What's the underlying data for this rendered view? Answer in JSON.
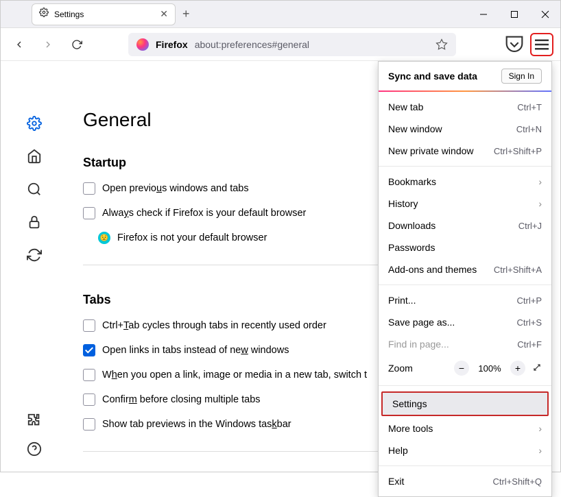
{
  "tab": {
    "title": "Settings"
  },
  "toolbar": {
    "brand": "Firefox",
    "url": "about:preferences#general"
  },
  "page": {
    "title": "General",
    "startup_heading": "Startup",
    "opt_prev": "Open previous windows and tabs",
    "opt_default": "Always check if Firefox is your default browser",
    "default_status": "Firefox is not your default browser",
    "tabs_heading": "Tabs",
    "opt_ctrltab": "Ctrl+Tab cycles through tabs in recently used order",
    "opt_openlinks": "Open links in tabs instead of new windows",
    "opt_switch": "When you open a link, image or media in a new tab, switch t",
    "opt_confirm": "Confirm before closing multiple tabs",
    "opt_taskbar": "Show tab previews in the Windows taskbar"
  },
  "menu": {
    "sync_title": "Sync and save data",
    "sign_in": "Sign In",
    "new_tab": "New tab",
    "new_tab_sc": "Ctrl+T",
    "new_window": "New window",
    "new_window_sc": "Ctrl+N",
    "new_private": "New private window",
    "new_private_sc": "Ctrl+Shift+P",
    "bookmarks": "Bookmarks",
    "history": "History",
    "downloads": "Downloads",
    "downloads_sc": "Ctrl+J",
    "passwords": "Passwords",
    "addons": "Add-ons and themes",
    "addons_sc": "Ctrl+Shift+A",
    "print": "Print...",
    "print_sc": "Ctrl+P",
    "save_as": "Save page as...",
    "save_as_sc": "Ctrl+S",
    "find": "Find in page...",
    "find_sc": "Ctrl+F",
    "zoom": "Zoom",
    "zoom_value": "100%",
    "settings": "Settings",
    "more_tools": "More tools",
    "help": "Help",
    "exit": "Exit",
    "exit_sc": "Ctrl+Shift+Q"
  }
}
